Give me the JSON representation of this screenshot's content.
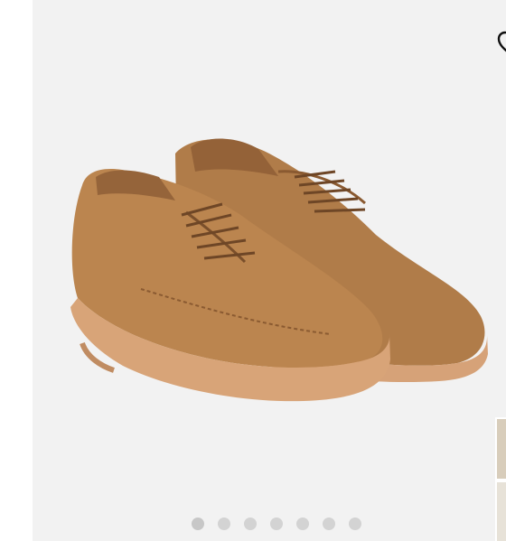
{
  "product": {
    "image_subject": "tan-suede-lace-up-oxford-pair",
    "colors": {
      "suede": "#b8824e",
      "suede_shadow": "#9a6a3c",
      "sole": "#d9a57b",
      "background": "#f2f2f2"
    }
  },
  "wishlist": {
    "icon": "heart-outline-icon"
  },
  "carousel": {
    "count": 7,
    "active_index": 0
  },
  "thumbnails": {
    "icon": "thumbnail-strip"
  }
}
